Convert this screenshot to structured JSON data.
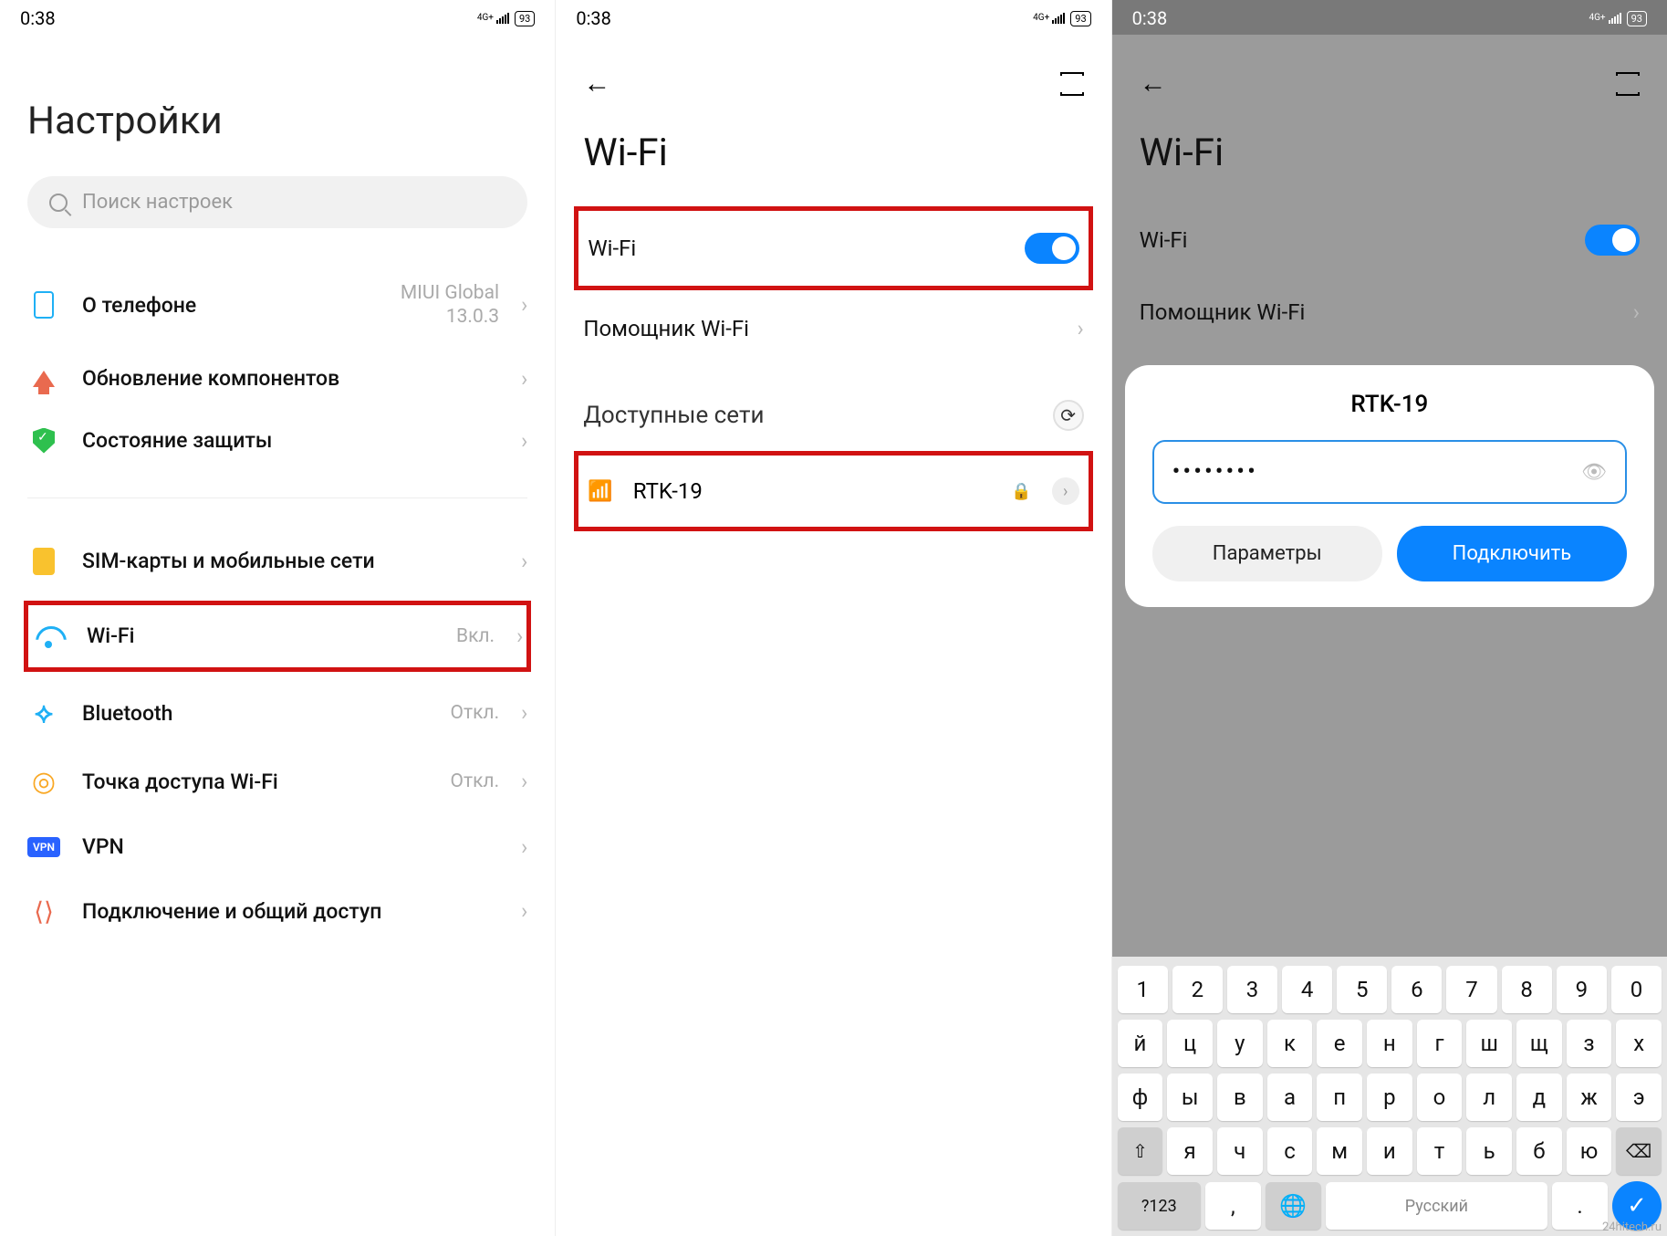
{
  "status": {
    "time": "0:38",
    "net": "4G+",
    "batt": "93"
  },
  "p1": {
    "title": "Настройки",
    "search_placeholder": "Поиск настроек",
    "about": {
      "label": "О телефоне",
      "status_l1": "MIUI Global",
      "status_l2": "13.0.3"
    },
    "update": "Обновление компонентов",
    "security": "Состояние защиты",
    "sim": "SIM-карты и мобильные сети",
    "wifi": {
      "label": "Wi-Fi",
      "status": "Вкл."
    },
    "bt": {
      "label": "Bluetooth",
      "status": "Откл."
    },
    "hotspot": {
      "label": "Точка доступа Wi-Fi",
      "status": "Откл."
    },
    "vpn": "VPN",
    "sharing": "Подключение и общий доступ"
  },
  "p2": {
    "title": "Wi-Fi",
    "toggle_label": "Wi-Fi",
    "assistant": "Помощник Wi-Fi",
    "available": "Доступные сети",
    "network": "RTK-19"
  },
  "p3": {
    "title": "Wi-Fi",
    "toggle_label": "Wi-Fi",
    "assistant": "Помощник Wi-Fi",
    "available": "Доступные сети",
    "dialog": {
      "ssid": "RTK-19",
      "password_masked": "••••••••",
      "params": "Параметры",
      "connect": "Подключить"
    },
    "kb": {
      "row1": [
        "1",
        "2",
        "3",
        "4",
        "5",
        "6",
        "7",
        "8",
        "9",
        "0"
      ],
      "row2": [
        "й",
        "ц",
        "у",
        "к",
        "е",
        "н",
        "г",
        "ш",
        "щ",
        "з",
        "х"
      ],
      "row3": [
        "ф",
        "ы",
        "в",
        "а",
        "п",
        "р",
        "о",
        "л",
        "д",
        "ж",
        "э"
      ],
      "row4": [
        "я",
        "ч",
        "с",
        "м",
        "и",
        "т",
        "ь",
        "б",
        "ю"
      ],
      "shift": "⇧",
      "bksp": "⌫",
      "nums": "?123",
      "comma": ",",
      "globe": "🌐",
      "space": "Русский",
      "dot": ".",
      "enter": "✓"
    }
  },
  "watermark": "24hitech.ru"
}
